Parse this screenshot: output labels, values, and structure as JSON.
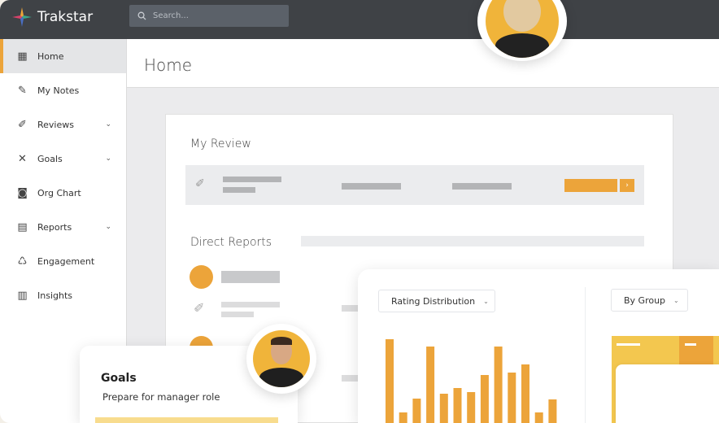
{
  "app": {
    "name": "Trakstar"
  },
  "search": {
    "placeholder": "Search..."
  },
  "sidebar": {
    "items": [
      {
        "label": "Home",
        "icon": "grid-icon",
        "active": true
      },
      {
        "label": "My Notes",
        "icon": "notes-icon"
      },
      {
        "label": "Reviews",
        "icon": "review-icon",
        "expandable": true
      },
      {
        "label": "Goals",
        "icon": "goals-icon",
        "expandable": true
      },
      {
        "label": "Org Chart",
        "icon": "org-chart-icon"
      },
      {
        "label": "Reports",
        "icon": "reports-icon",
        "expandable": true
      },
      {
        "label": "Engagement",
        "icon": "engagement-icon"
      },
      {
        "label": "Insights",
        "icon": "insights-icon"
      }
    ]
  },
  "header": {
    "title": "Home"
  },
  "main": {
    "my_review": "My Review",
    "direct_reports": "Direct Reports"
  },
  "analytics": {
    "chart_select": "Rating Distribution",
    "group_select": "By Group"
  },
  "goals_card": {
    "title": "Goals",
    "goal": "Prepare for manager role"
  },
  "colors": {
    "accent": "#eca43a",
    "topbar": "#3f4246"
  },
  "chart_data": {
    "type": "bar",
    "values": [
      103,
      13,
      30,
      94,
      36,
      43,
      38,
      59,
      94,
      62,
      72,
      13,
      29
    ],
    "grid": false
  }
}
